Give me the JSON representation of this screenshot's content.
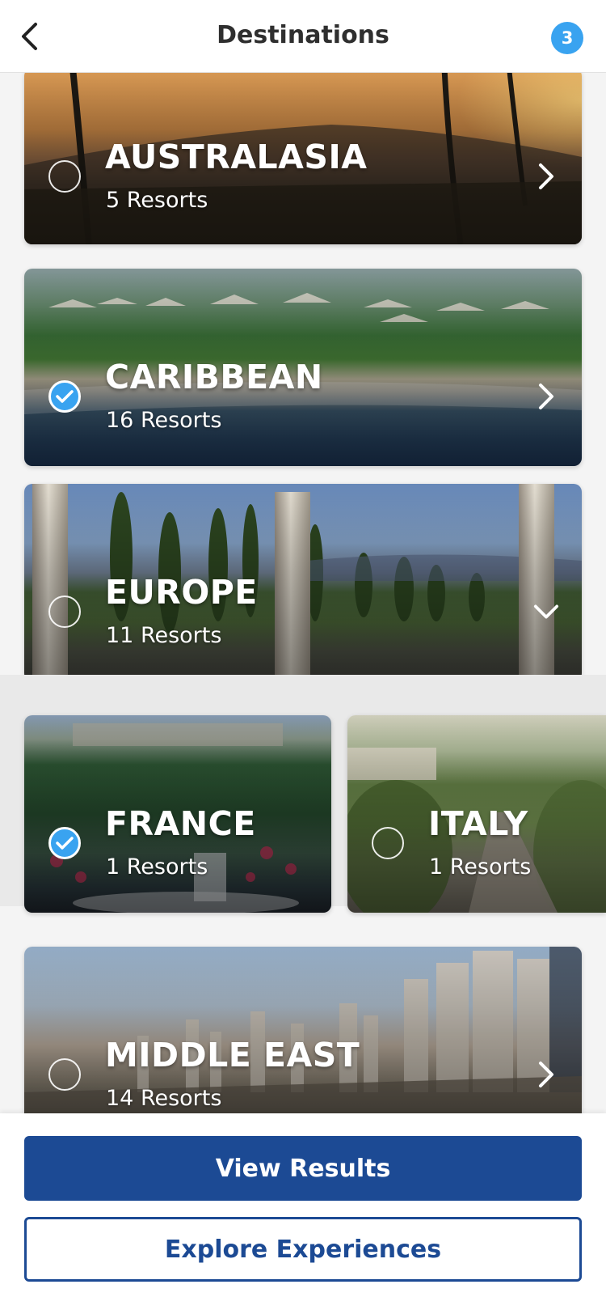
{
  "header": {
    "title": "Destinations",
    "selected_count": "3"
  },
  "destinations": [
    {
      "name": "AUSTRALASIA",
      "resorts": "5 Resorts",
      "selected": false,
      "action": "chevron-right"
    },
    {
      "name": "CARIBBEAN",
      "resorts": "16 Resorts",
      "selected": true,
      "action": "chevron-right"
    },
    {
      "name": "EUROPE",
      "resorts": "11 Resorts",
      "selected": false,
      "action": "chevron-down",
      "expanded": true,
      "children": [
        {
          "name": "FRANCE",
          "resorts": "1 Resorts",
          "selected": true
        },
        {
          "name": "ITALY",
          "resorts": "1 Resorts",
          "selected": false
        }
      ]
    },
    {
      "name": "MIDDLE EAST",
      "resorts": "14 Resorts",
      "selected": false,
      "action": "chevron-right"
    }
  ],
  "footer": {
    "primary_label": "View Results",
    "secondary_label": "Explore Experiences"
  },
  "colors": {
    "accent_blue": "#39a3f0",
    "brand_navy": "#1c4a94"
  }
}
